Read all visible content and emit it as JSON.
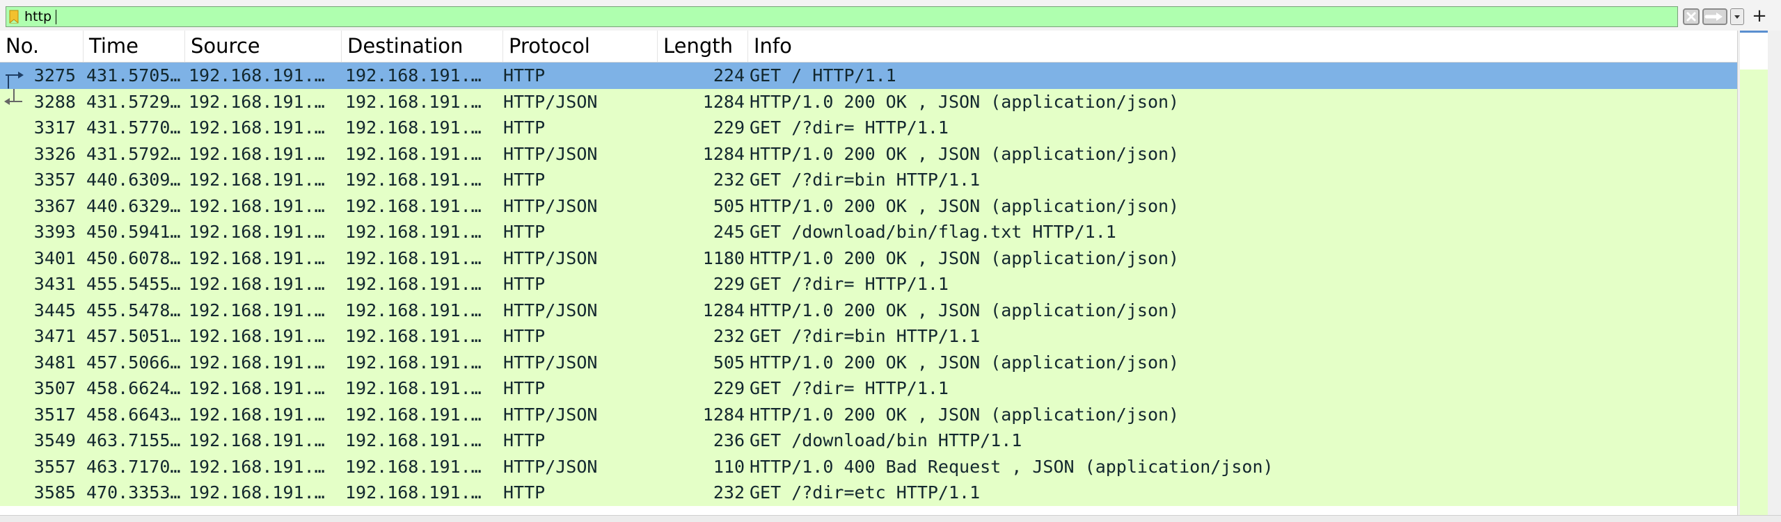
{
  "filter": {
    "value": "http",
    "add_label": "+"
  },
  "columns": [
    "No.",
    "Time",
    "Source",
    "Destination",
    "Protocol",
    "Length",
    "Info"
  ],
  "packets": [
    {
      "no": "3275",
      "time": "431.5705…",
      "src": "192.168.191.…",
      "dst": "192.168.191.…",
      "proto": "HTTP",
      "len": "224",
      "info": "GET / HTTP/1.1"
    },
    {
      "no": "3288",
      "time": "431.5729…",
      "src": "192.168.191.…",
      "dst": "192.168.191.…",
      "proto": "HTTP/JSON",
      "len": "1284",
      "info": "HTTP/1.0 200 OK , JSON (application/json)"
    },
    {
      "no": "3317",
      "time": "431.5770…",
      "src": "192.168.191.…",
      "dst": "192.168.191.…",
      "proto": "HTTP",
      "len": "229",
      "info": "GET /?dir= HTTP/1.1"
    },
    {
      "no": "3326",
      "time": "431.5792…",
      "src": "192.168.191.…",
      "dst": "192.168.191.…",
      "proto": "HTTP/JSON",
      "len": "1284",
      "info": "HTTP/1.0 200 OK , JSON (application/json)"
    },
    {
      "no": "3357",
      "time": "440.6309…",
      "src": "192.168.191.…",
      "dst": "192.168.191.…",
      "proto": "HTTP",
      "len": "232",
      "info": "GET /?dir=bin HTTP/1.1"
    },
    {
      "no": "3367",
      "time": "440.6329…",
      "src": "192.168.191.…",
      "dst": "192.168.191.…",
      "proto": "HTTP/JSON",
      "len": "505",
      "info": "HTTP/1.0 200 OK , JSON (application/json)"
    },
    {
      "no": "3393",
      "time": "450.5941…",
      "src": "192.168.191.…",
      "dst": "192.168.191.…",
      "proto": "HTTP",
      "len": "245",
      "info": "GET /download/bin/flag.txt HTTP/1.1"
    },
    {
      "no": "3401",
      "time": "450.6078…",
      "src": "192.168.191.…",
      "dst": "192.168.191.…",
      "proto": "HTTP/JSON",
      "len": "1180",
      "info": "HTTP/1.0 200 OK , JSON (application/json)"
    },
    {
      "no": "3431",
      "time": "455.5455…",
      "src": "192.168.191.…",
      "dst": "192.168.191.…",
      "proto": "HTTP",
      "len": "229",
      "info": "GET /?dir= HTTP/1.1"
    },
    {
      "no": "3445",
      "time": "455.5478…",
      "src": "192.168.191.…",
      "dst": "192.168.191.…",
      "proto": "HTTP/JSON",
      "len": "1284",
      "info": "HTTP/1.0 200 OK , JSON (application/json)"
    },
    {
      "no": "3471",
      "time": "457.5051…",
      "src": "192.168.191.…",
      "dst": "192.168.191.…",
      "proto": "HTTP",
      "len": "232",
      "info": "GET /?dir=bin HTTP/1.1"
    },
    {
      "no": "3481",
      "time": "457.5066…",
      "src": "192.168.191.…",
      "dst": "192.168.191.…",
      "proto": "HTTP/JSON",
      "len": "505",
      "info": "HTTP/1.0 200 OK , JSON (application/json)"
    },
    {
      "no": "3507",
      "time": "458.6624…",
      "src": "192.168.191.…",
      "dst": "192.168.191.…",
      "proto": "HTTP",
      "len": "229",
      "info": "GET /?dir= HTTP/1.1"
    },
    {
      "no": "3517",
      "time": "458.6643…",
      "src": "192.168.191.…",
      "dst": "192.168.191.…",
      "proto": "HTTP/JSON",
      "len": "1284",
      "info": "HTTP/1.0 200 OK , JSON (application/json)"
    },
    {
      "no": "3549",
      "time": "463.7155…",
      "src": "192.168.191.…",
      "dst": "192.168.191.…",
      "proto": "HTTP",
      "len": "236",
      "info": "GET /download/bin HTTP/1.1"
    },
    {
      "no": "3557",
      "time": "463.7170…",
      "src": "192.168.191.…",
      "dst": "192.168.191.…",
      "proto": "HTTP/JSON",
      "len": "110",
      "info": "HTTP/1.0 400 Bad Request , JSON (application/json)"
    },
    {
      "no": "3585",
      "time": "470.3353…",
      "src": "192.168.191.…",
      "dst": "192.168.191.…",
      "proto": "HTTP",
      "len": "232",
      "info": "GET /?dir=etc HTTP/1.1"
    }
  ],
  "selected_packet": "3275",
  "colors": {
    "filter_valid_bg": "#afffaf",
    "row_bg": "#e4ffc7",
    "row_selected_bg": "#7eb2e6"
  },
  "icons": {
    "bookmark": "bookmark-icon",
    "clear": "clear-filter-icon",
    "apply": "apply-filter-arrow-icon",
    "dropdown": "chevron-down-icon",
    "request": "request-arrow-icon",
    "response": "response-arrow-icon"
  }
}
